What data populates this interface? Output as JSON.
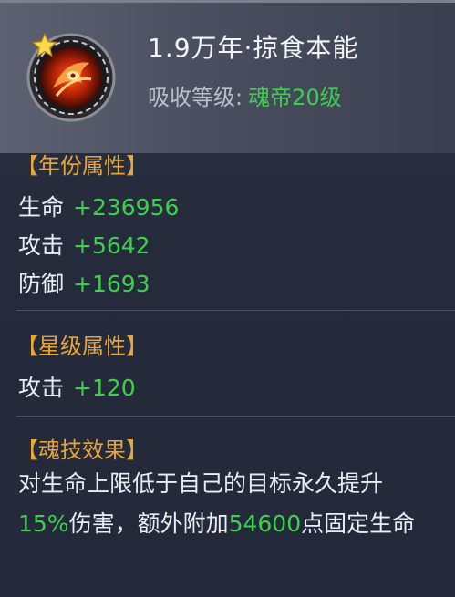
{
  "skill": {
    "title": "1.9万年·掠食本能",
    "absorb_label": "吸收等级:",
    "absorb_value": "魂帝20级",
    "icon": "star-icon"
  },
  "sections": {
    "year": {
      "header": "【年份属性】",
      "stats": [
        {
          "name": "生命",
          "value": "+236956"
        },
        {
          "name": "攻击",
          "value": "+5642"
        },
        {
          "name": "防御",
          "value": "+1693"
        }
      ]
    },
    "star": {
      "header": "【星级属性】",
      "stats": [
        {
          "name": "攻击",
          "value": "+120"
        }
      ]
    },
    "effect": {
      "header": "【魂技效果】",
      "line1": "对生命上限低于自己的目标永久提升",
      "pct": "15%",
      "mid": "伤害，额外附加",
      "dmg": "54600",
      "tail": "点固定生命"
    }
  },
  "colors": {
    "green": "#3fcf4e",
    "gold": "#e6a63a",
    "text": "#e9eef5"
  }
}
